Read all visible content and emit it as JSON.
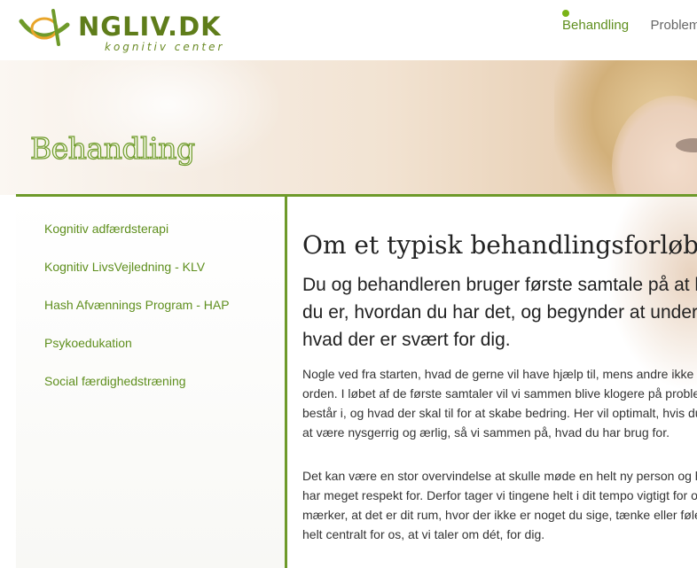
{
  "logo": {
    "text": "NGLIV.DK",
    "subtitle": "kognitiv center"
  },
  "nav": {
    "items": [
      {
        "label": "Behandling",
        "active": true
      },
      {
        "label": "Problemt"
      }
    ]
  },
  "hero": {
    "title": "Behandling"
  },
  "sidebar": {
    "items": [
      {
        "label": "Kognitiv adfærdsterapi"
      },
      {
        "label": "Kognitiv LivsVejledning - KLV"
      },
      {
        "label": "Hash Afvænnings Program - HAP"
      },
      {
        "label": "Psykoedukation"
      },
      {
        "label": "Social færdighedstræning"
      }
    ]
  },
  "main": {
    "title": "Om et typisk behandlingsforløb:",
    "lead": "Du og behandleren bruger første samtale på at hvem du er, hvordan du har det, og begynder at undersøge, hvad der er svært for dig.",
    "paragraphs": [
      "Nogle ved fra starten, hvad de gerne vil have hjælp til, mens andre ikke er helt i orden. I løbet af de første samtaler vil vi sammen blive klogere på problemerne består i, og hvad der skal til for at skabe bedring. Her vil optimalt, hvis du er med på at være nysgerrig og ærlig, så vi sammen på, hvad du har brug for.",
      "Det kan være en stor overvindelse at skulle møde en helt ny person og hvilket vi har meget respekt for. Derfor tager vi tingene helt i dit tempo vigtigt for os, at du mærker, at det er dit rum, hvor der ikke er noget du sige, tænke eller føle, og det er helt centralt for os, at vi taler om dét, for dig."
    ]
  },
  "colors": {
    "accent": "#6e9a2a",
    "link": "#5f8f1e",
    "nav_dot": "#7ab317"
  }
}
